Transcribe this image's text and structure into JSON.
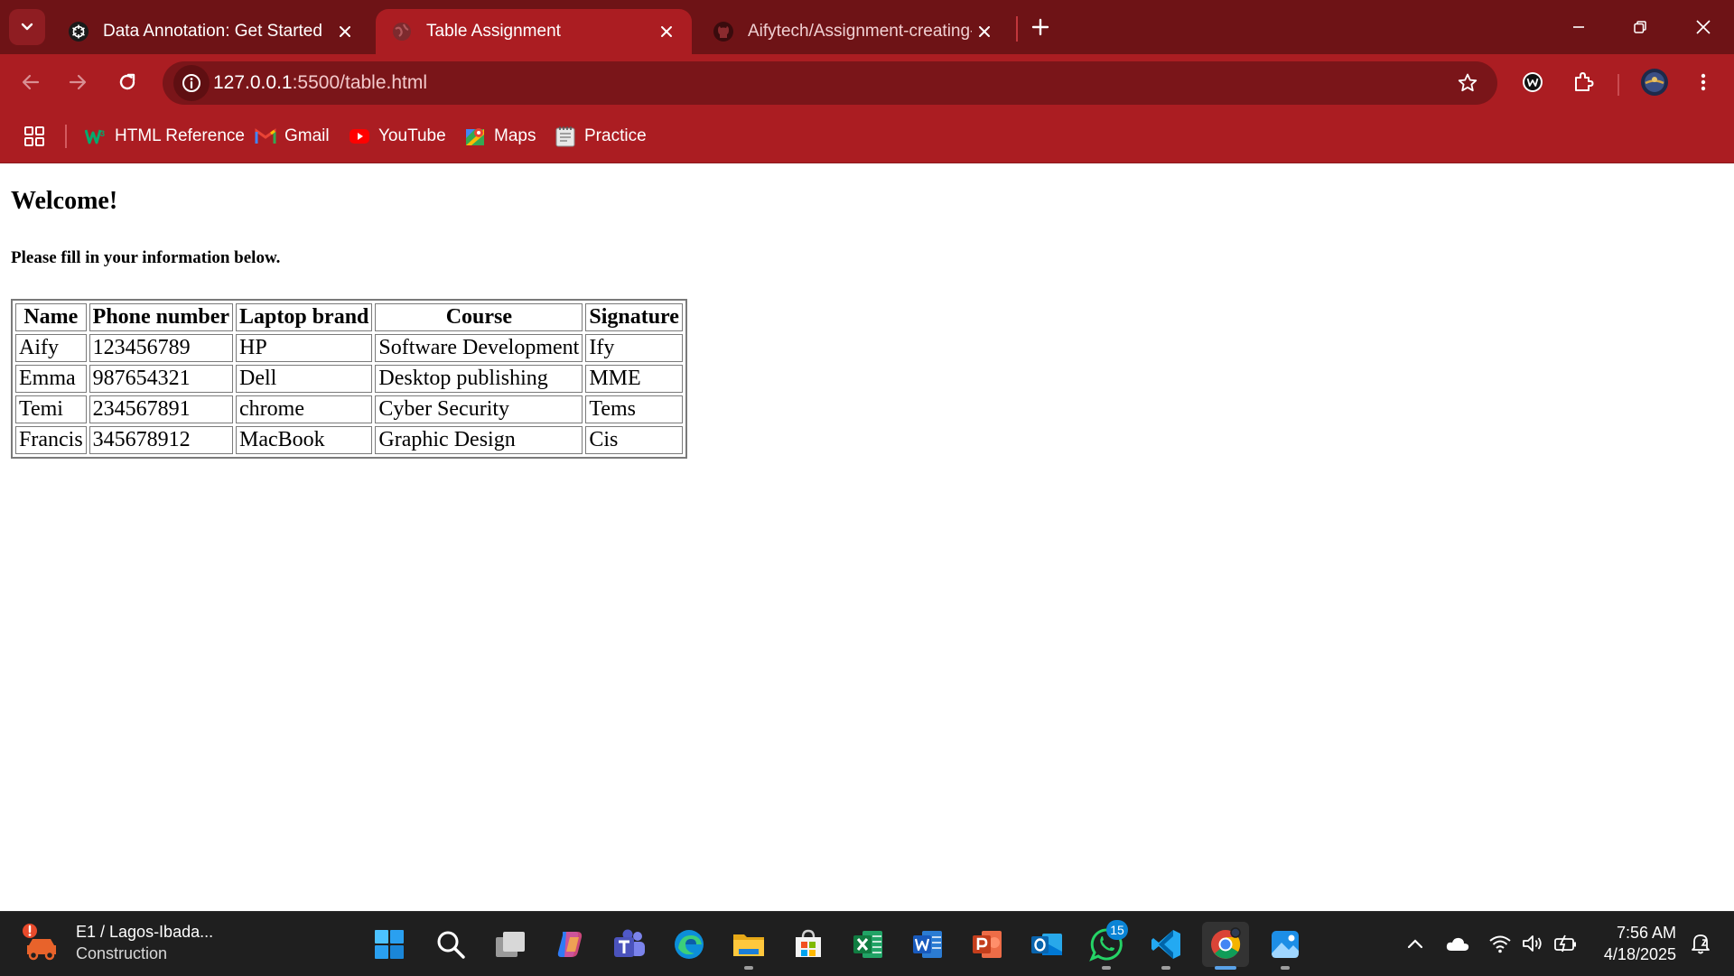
{
  "browser": {
    "tabs": [
      {
        "title": "Data Annotation: Get Started",
        "icon": "openai-icon",
        "active": false
      },
      {
        "title": "Table Assignment",
        "icon": "globe-icon",
        "active": true
      },
      {
        "title": "Aifytech/Assignment-creating-t",
        "icon": "github-icon",
        "active": false
      }
    ],
    "url_host": "127.0.0.1",
    "url_rest": ":5500/table.html",
    "bookmarks": [
      {
        "label": "HTML Reference",
        "icon": "w3schools-icon"
      },
      {
        "label": "Gmail",
        "icon": "gmail-icon"
      },
      {
        "label": "YouTube",
        "icon": "youtube-icon"
      },
      {
        "label": "Maps",
        "icon": "maps-icon"
      },
      {
        "label": "Practice",
        "icon": "practice-icon"
      }
    ],
    "colors": {
      "frame": "#6e1316",
      "toolbar": "#ab1d22",
      "omnibox": "#7a1519"
    }
  },
  "page": {
    "heading": "Welcome!",
    "subheading": "Please fill in your information below.",
    "table": {
      "headers": [
        "Name",
        "Phone number",
        "Laptop brand",
        "Course",
        "Signature"
      ],
      "rows": [
        [
          "Aify",
          "123456789",
          "HP",
          "Software Development",
          "Ify"
        ],
        [
          "Emma",
          "987654321",
          "Dell",
          "Desktop publishing",
          "MME"
        ],
        [
          "Temi",
          "234567891",
          "chrome",
          "Cyber Security",
          "Tems"
        ],
        [
          "Francis",
          "345678912",
          "MacBook",
          "Graphic Design",
          "Cis"
        ]
      ]
    }
  },
  "taskbar": {
    "news_title": "E1 / Lagos-Ibada...",
    "news_sub": "Construction",
    "apps": [
      "start-icon",
      "search-icon",
      "task-view-icon",
      "copilot-icon",
      "teams-icon",
      "edge-icon",
      "file-explorer-icon",
      "store-icon",
      "excel-icon",
      "word-icon",
      "powerpoint-icon",
      "outlook-icon",
      "whatsapp-icon",
      "vscode-icon",
      "chrome-icon",
      "photos-icon"
    ],
    "whatsapp_badge": "15",
    "time": "7:56 AM",
    "date": "4/18/2025"
  }
}
